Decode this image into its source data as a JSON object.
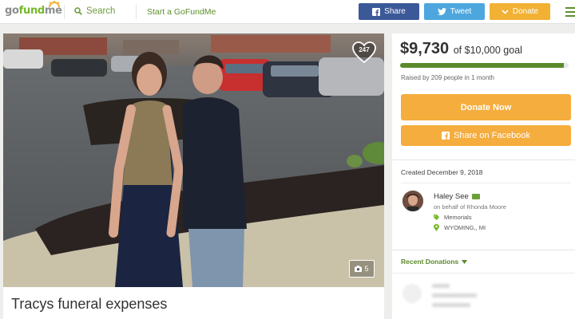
{
  "header": {
    "logo": {
      "go": "go",
      "fund": "fund",
      "me": "me"
    },
    "search_label": "Search",
    "start_label": "Start a GoFundMe",
    "share_label": "Share",
    "tweet_label": "Tweet",
    "donate_label": "Donate"
  },
  "photo": {
    "heart_count": "247",
    "photo_count": "5"
  },
  "campaign": {
    "title": "Tracys funeral expenses"
  },
  "funding": {
    "raised": "$9,730",
    "goal_text": "of $10,000 goal",
    "progress": 0.973,
    "raised_by": "Raised by 209 people in 1 month",
    "donate_now_label": "Donate Now",
    "share_facebook_label": "Share on Facebook"
  },
  "organizer": {
    "created": "Created December 9, 2018",
    "name": "Haley See",
    "on_behalf": "on behalf of Rhonda Moore",
    "category": "Memorials",
    "location": "WYOMING,, MI"
  },
  "donations": {
    "heading": "Recent Donations"
  },
  "colors": {
    "brand_green": "#76b82a",
    "facebook": "#3b5998",
    "twitter": "#4da7de",
    "donate": "#f2b134"
  },
  "icons": [
    "search-icon",
    "facebook-icon",
    "twitter-icon",
    "heart-icon",
    "camera-icon",
    "verified-icon",
    "tag-icon",
    "location-pin-icon",
    "chevron-down-icon",
    "menu-icon"
  ]
}
